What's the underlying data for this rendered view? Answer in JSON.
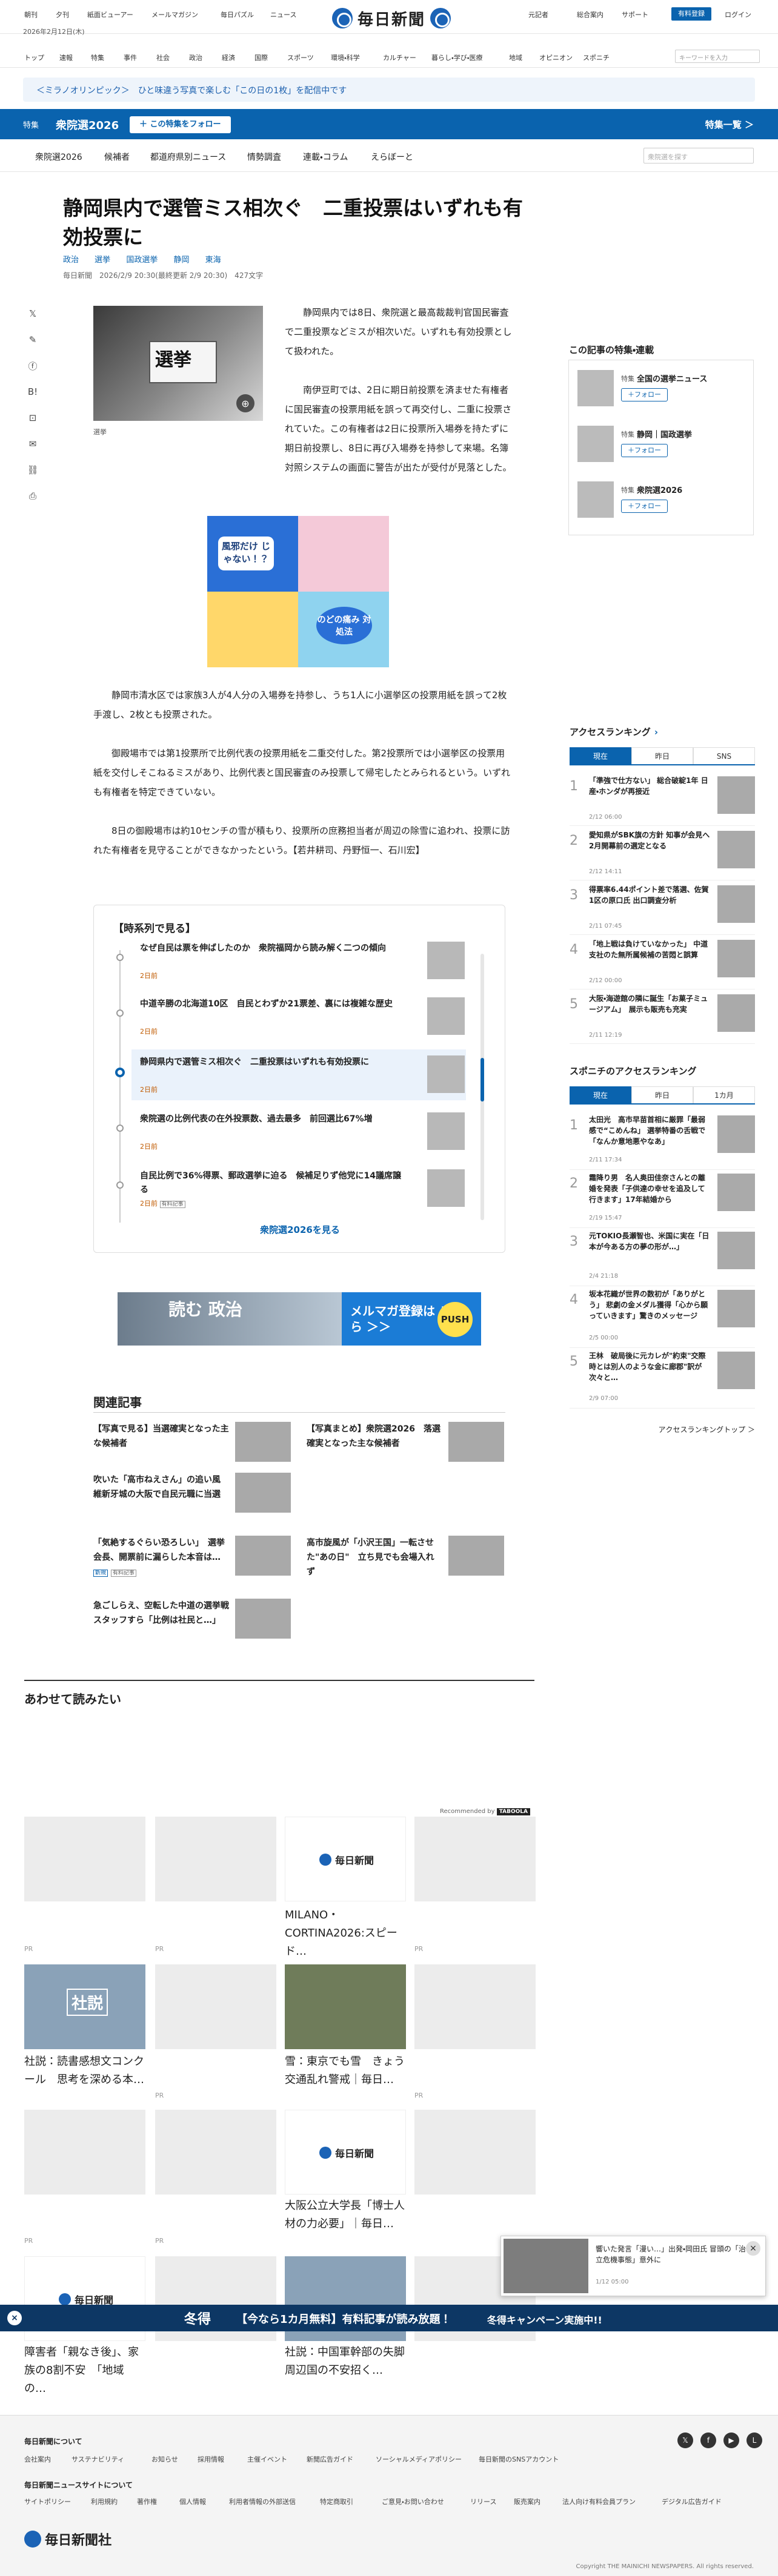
{
  "header": {
    "top_links": [
      "朝刊",
      "夕刊",
      "紙面ビューアー",
      "メールマガジン",
      "毎日パズル",
      "ニュース"
    ],
    "date": "2026年2月12日(木)",
    "logo": "毎日新聞",
    "right_links": [
      "元記者",
      "総合案内",
      "サポート"
    ],
    "register": "有料登録",
    "login": "ログイン"
  },
  "nav": {
    "items": [
      "トップ",
      "速報",
      "特集",
      "事件",
      "社会",
      "政治",
      "経済",
      "国際",
      "スポーツ",
      "環境・科学",
      "カルチャー",
      "暮らし・学び・医療",
      "地域",
      "オピニオン",
      "スポニチ"
    ],
    "search_placeholder": "キーワードを入力"
  },
  "notice": "＜ミラノオリンピック＞　ひと味違う写真で楽しむ「この日の1枚」を配信中です",
  "feature": {
    "label": "特集",
    "title": "衆院選2026",
    "follow": "＋ この特集をフォロー",
    "list": "特集一覧 ＞"
  },
  "subnav": {
    "items": [
      "衆院選2026",
      "候補者",
      "都道府県別ニュース",
      "情勢調査",
      "連載・コラム",
      "えらぼーと"
    ],
    "search_placeholder": "衆院選を探す"
  },
  "article": {
    "title": "静岡県内で選管ミス相次ぐ　二重投票はいずれも有効投票に",
    "tags": [
      "政治",
      "選挙",
      "国政選挙",
      "静岡",
      "東海"
    ],
    "meta": "毎日新聞　2026/2/9 20:30(最終更新 2/9 20:30)　427文字",
    "photo_caption": "選挙",
    "photo_text": "選挙",
    "p1": "静岡県内では8日、衆院選と最高裁裁判官国民審査で二重投票などミスが相次いだ。いずれも有効投票として扱われた。",
    "p2": "南伊豆町では、2日に期日前投票を済ませた有権者に国民審査の投票用紙を誤って再交付し、二重に投票されていた。この有権者は2日に投票所入場券を持たずに期日前投票し、8日に再び入場券を持参して来場。名簿対照システムの画面に警告が出たが受付が見落とした。",
    "p3": "静岡市清水区では家族3人が4人分の入場券を持参し、うち1人に小選挙区の投票用紙を誤って2枚手渡し、2枚とも投票された。",
    "p4": "御殿場市では第1投票所で比例代表の投票用紙を二重交付した。第2投票所では小選挙区の投票用紙を交付しそこねるミスがあり、比例代表と国民審査のみ投票して帰宅したとみられるという。いずれも有権者を特定できていない。",
    "p5": "8日の御殿場市は約10センチの雪が積もり、投票所の庶務担当者が周辺の除雪に追われ、投票に訪れた有権者を見守ることができなかったという。【若井耕司、丹野恒一、石川宏】",
    "ad1_a": "風邪だけ じゃない！？",
    "ad1_b": "のどの痛み 対処法"
  },
  "series": {
    "heading": "【時系列で見る】",
    "items": [
      {
        "title": "なぜ自民は票を伸ばしたのか　衆院福岡から読み解く二つの傾向",
        "date": "2日前"
      },
      {
        "title": "中道辛勝の北海道10区　自民とわずか21票差、裏には複雑な歴史",
        "date": "2日前"
      },
      {
        "title": "静岡県内で選管ミス相次ぐ　二重投票はいずれも有効投票に",
        "date": "2日前"
      },
      {
        "title": "衆院選の比例代表の在外投票数、過去最多　前回選比67%増",
        "date": "2日前"
      },
      {
        "title": "自民比例で36%得票、郵政選挙に迫る　候補足りず他党に14議席譲る",
        "date": "2日前"
      }
    ],
    "badge": "有料記事",
    "more": "衆院選2026を見る"
  },
  "ad2": {
    "left": "読む 政治",
    "right": "メルマガ登録は こちら ＞＞",
    "push": "PUSH"
  },
  "related": {
    "heading": "関連記事",
    "items": [
      "【写真で見る】当選確実となった主な候補者",
      "【写真まとめ】衆院選2026　落選確実となった主な候補者",
      "吹いた「高市ねえさん」の追い風 維新牙城の大阪で自民元職に当選",
      "高市旋風が「小沢王国」一転させた\"あの日\"　立ち見でも会場入れず",
      "「気絶するぐらい恐ろしい」　選挙会長、開票前に漏らした本音は…",
      "急ごしらえ、空転した中道の選挙戦　スタッフすら「比例は社民と…」"
    ],
    "new_badge": "新規",
    "pay_badge": "有料記事"
  },
  "awase": {
    "heading": "あわせて読みたい",
    "recommended": "Recommended by",
    "cards": [
      "MILANO・CORTINA2026:スピード…",
      "社説：読書感想文コンクール　思考を深める本…",
      "雪：東京でも雪　きょう交通乱れ警戒｜毎日…",
      "大阪公立大学長「博士人材の力必要」｜毎日…",
      "障害者「親なき後」、家族の8割不安　「地域の…",
      "社説：中国軍幹部の失脚　周辺国の不安招く…"
    ],
    "pr": "PR"
  },
  "sidebar": {
    "follow_heading": "この記事の特集・連載",
    "follow": [
      {
        "kind": "特集",
        "name": "全国の選挙ニュース"
      },
      {
        "kind": "特集",
        "name": "静岡｜国政選挙"
      },
      {
        "kind": "特集",
        "name": "衆院選2026"
      }
    ],
    "follow_btn": "＋フォロー",
    "rank_heading": "アクセスランキング",
    "rank_tabs": [
      "現在",
      "昨日",
      "SNS"
    ],
    "rank": [
      {
        "title": "「準強で仕方ない」 総合破綻1年 日産・ホンダが再接近",
        "date": "2/12 06:00"
      },
      {
        "title": "愛知県がSBK旗の方針 知事が会見へ　2月開幕前の選定となる",
        "date": "2/12 14:11"
      },
      {
        "title": "得票率6.44ポイント差で落選、佐賀1区の原口氏 出口調査分析",
        "date": "2/11 07:45"
      },
      {
        "title": "「地上戦は負けていなかった」 中道支社のた無所属候補の苦悶と誤算",
        "date": "2/12 00:00"
      },
      {
        "title": "大阪・海遊館の隣に誕生「お菓子ミュージアム」　展示も販売も充実",
        "date": "2/11 12:19"
      }
    ],
    "sponichi_heading": "スポニチのアクセスランキング",
    "sponichi_tabs": [
      "現在",
      "昨日",
      "1カ月"
    ],
    "sponichi": [
      {
        "title": "太田光　高市早苗首相に厳罪「最弱感で“こめんね」 選挙特番の舌戦で「なんか意地悪やなあ」",
        "date": "2/11 17:34"
      },
      {
        "title": "霜降り男　名人奥田佳奈さんとの離婚を発表「子供達の幸せを追及して行きます」17年結婚から",
        "date": "2/19 15:47"
      },
      {
        "title": "元TOKIO長瀬智也、米国に実在「日本が今ある方の夢の形が…」",
        "date": "2/4 21:18"
      },
      {
        "title": "坂本花織が世界の数初が「ありがとう」 悲劇の金メダル獲得「心から願っていきます」驚きのメッセージ",
        "date": "2/5 00:00"
      },
      {
        "title": "王林　破局後に元カレが\"約束\"交際時とは別人のような金に廊郡\"訳が次々と…",
        "date": "2/9 07:00"
      }
    ],
    "rank_more": "アクセスランキングトップ ＞"
  },
  "popup": {
    "title": "響いた発言「漫い…」出発・岡田氏 冒頭の「治立危機事態」意外に",
    "date": "1/12 05:00"
  },
  "winter": {
    "kikan": "冬得",
    "main": "【今なら1カ月無料】有料記事が読み放題！",
    "campaign": "冬得キャンペーン実施中!!"
  },
  "footer": {
    "about": "毎日新聞について",
    "about_links": [
      "会社案内",
      "サステナビリティ",
      "お知らせ",
      "採用情報",
      "主催イベント",
      "新聞広告ガイド",
      "ソーシャルメディアポリシー",
      "毎日新聞のSNSアカウント"
    ],
    "site": "毎日新聞ニュースサイトについて",
    "site_links": [
      "サイトポリシー",
      "利用規約",
      "著作権",
      "個人情報",
      "利用者情報の外部送信",
      "特定商取引",
      "ご意見・お問い合わせ",
      "リリース",
      "販売案内",
      "法人向け有料会員プラン",
      "デジタル広告ガイド"
    ],
    "company": "毎日新聞社",
    "copyright": "Copyright THE MAINICHI NEWSPAPERS. All rights reserved."
  }
}
